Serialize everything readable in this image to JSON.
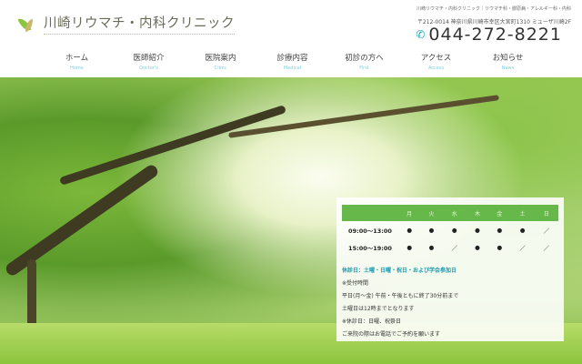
{
  "header": {
    "logo_text": "川崎リウマチ・内科クリニック",
    "tagline": "川崎リウマチ・内科クリニック｜リウマチ科・膠原病・アレルギー科・内科",
    "address": "〒212-0014 神奈川県川崎市幸区大宮町1310 ミューザ川崎2F",
    "phone": "044-272-8221"
  },
  "nav": [
    {
      "jp": "ホーム",
      "en": "Home"
    },
    {
      "jp": "医師紹介",
      "en": "Doctor's"
    },
    {
      "jp": "医院案内",
      "en": "Clinic"
    },
    {
      "jp": "診療内容",
      "en": "Medical"
    },
    {
      "jp": "初診の方へ",
      "en": "First"
    },
    {
      "jp": "アクセス",
      "en": "Access"
    },
    {
      "jp": "お知らせ",
      "en": "News"
    }
  ],
  "schedule": {
    "days": [
      "月",
      "火",
      "水",
      "木",
      "金",
      "土",
      "日"
    ],
    "rows": [
      {
        "time": "09:00～13:00",
        "marks": [
          "●",
          "●",
          "●",
          "●",
          "●",
          "●",
          "／"
        ]
      },
      {
        "time": "15:00～19:00",
        "marks": [
          "●",
          "●",
          "／",
          "●",
          "●",
          "／",
          "／"
        ]
      }
    ]
  },
  "notes": {
    "holiday": "休診日：土曜・日曜・祝日・および学会参加日",
    "lines": [
      "※受付時間",
      "平日(月～金) 午前・午後ともに終了30分前まで",
      "土曜日は12時までとなります",
      "※休診日：日曜、祝祭日",
      "ご来院の際はお電話でご予約を願います"
    ]
  }
}
